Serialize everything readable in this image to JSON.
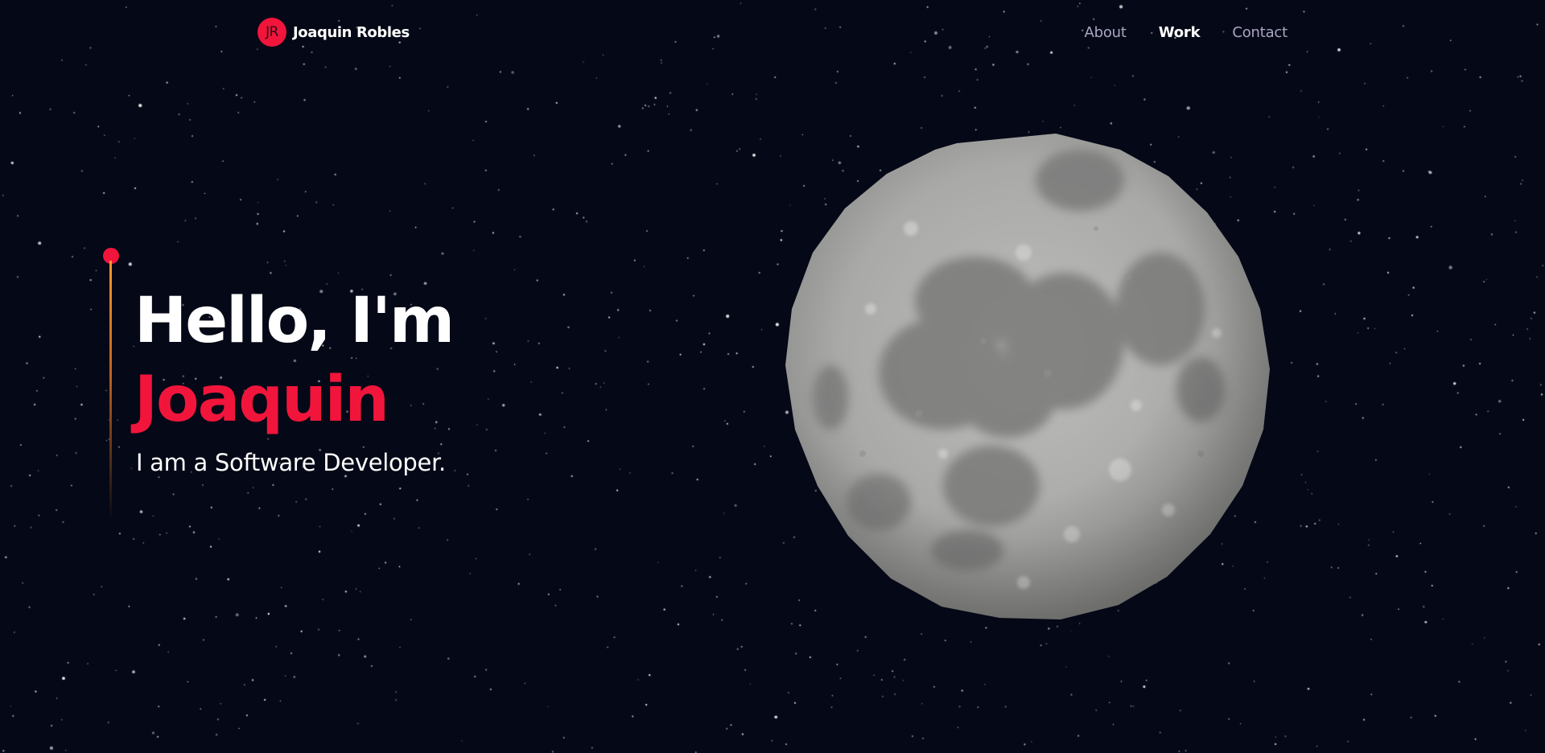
{
  "navbar": {
    "logo_initials": "JR",
    "brand_name": "Joaquin Robles",
    "links": [
      {
        "label": "About",
        "active": false
      },
      {
        "label": "Work",
        "active": true
      },
      {
        "label": "Contact",
        "active": false
      }
    ]
  },
  "hero": {
    "greeting": "Hello, I'm",
    "name": "Joaquin",
    "subtitle": "I am a Software Developer."
  },
  "colors": {
    "background": "#050816",
    "accent": "#f1153c",
    "nav_text": "#aaa6c3",
    "indicator_line": "#f59a2b"
  },
  "icons": {
    "logo": "jr-logo-icon",
    "moon": "moon-icon"
  }
}
